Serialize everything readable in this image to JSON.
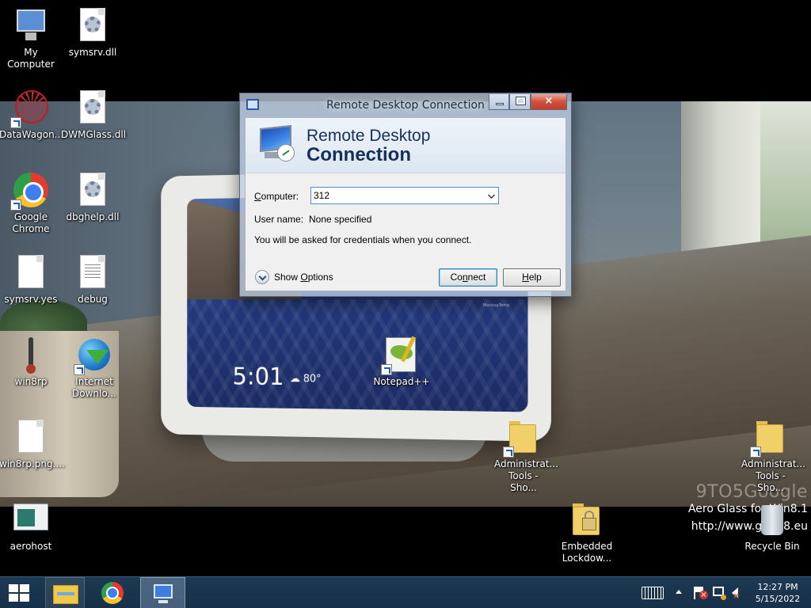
{
  "desktop": {
    "icons": [
      {
        "label": "My Computer",
        "icon": "computer-icon"
      },
      {
        "label": "symsrv.dll",
        "icon": "dll-file-icon"
      },
      {
        "label": "DataWagon...",
        "icon": "datawagon-shortcut-icon"
      },
      {
        "label": "DWMGlass.dll",
        "icon": "dll-file-icon"
      },
      {
        "label": "Google Chrome",
        "icon": "chrome-shortcut-icon"
      },
      {
        "label": "dbghelp.dll",
        "icon": "dll-file-icon"
      },
      {
        "label": "symsrv.yes",
        "icon": "blank-file-icon"
      },
      {
        "label": "debug",
        "icon": "text-file-icon"
      },
      {
        "label": "win8rp",
        "icon": "thermometer-icon"
      },
      {
        "label": "Internet Downlo...",
        "icon": "internet-download-manager-shortcut-icon"
      },
      {
        "label": "Notepad++",
        "icon": "notepad-plus-plus-shortcut-icon"
      },
      {
        "label": "win8rp.png....",
        "icon": "blank-file-icon"
      },
      {
        "label": "Administrat... Tools - Sho...",
        "icon": "folder-shortcut-icon"
      },
      {
        "label": "Administrat... Tools - Sho...",
        "icon": "folder-shortcut-icon"
      },
      {
        "label": "aerohost",
        "icon": "app-window-icon"
      },
      {
        "label": "Embedded Lockdow...",
        "icon": "locked-folder-icon"
      },
      {
        "label": "Recycle Bin",
        "icon": "recycle-bin-icon"
      }
    ]
  },
  "wallpaper": {
    "clock": "5:01",
    "weather": "☁ 80°",
    "tiny_label": "MockupTemp"
  },
  "watermark": {
    "brand": "9TO5Google",
    "line1": "Aero Glass for Win8.1",
    "line2": "http://www.glass8.eu"
  },
  "rdc": {
    "title": "Remote Desktop Connection",
    "header_line1": "Remote Desktop",
    "header_line2": "Connection",
    "computer_label_prefix": "C",
    "computer_label_rest": "omputer:",
    "computer_value": "312",
    "username_label": "User name:",
    "username_value": "None specified",
    "credentials_message": "You will be asked for credentials when you connect.",
    "show_options_prefix": "Show ",
    "show_options_accel": "O",
    "show_options_rest": "ptions",
    "connect_prefix": "Co",
    "connect_accel": "n",
    "connect_rest": "nect",
    "help_accel": "H",
    "help_rest": "elp",
    "minimize_symbol": "",
    "maximize_symbol": "",
    "close_symbol": "×"
  },
  "taskbar": {
    "time": "12:27 PM",
    "date": "5/15/2022"
  }
}
